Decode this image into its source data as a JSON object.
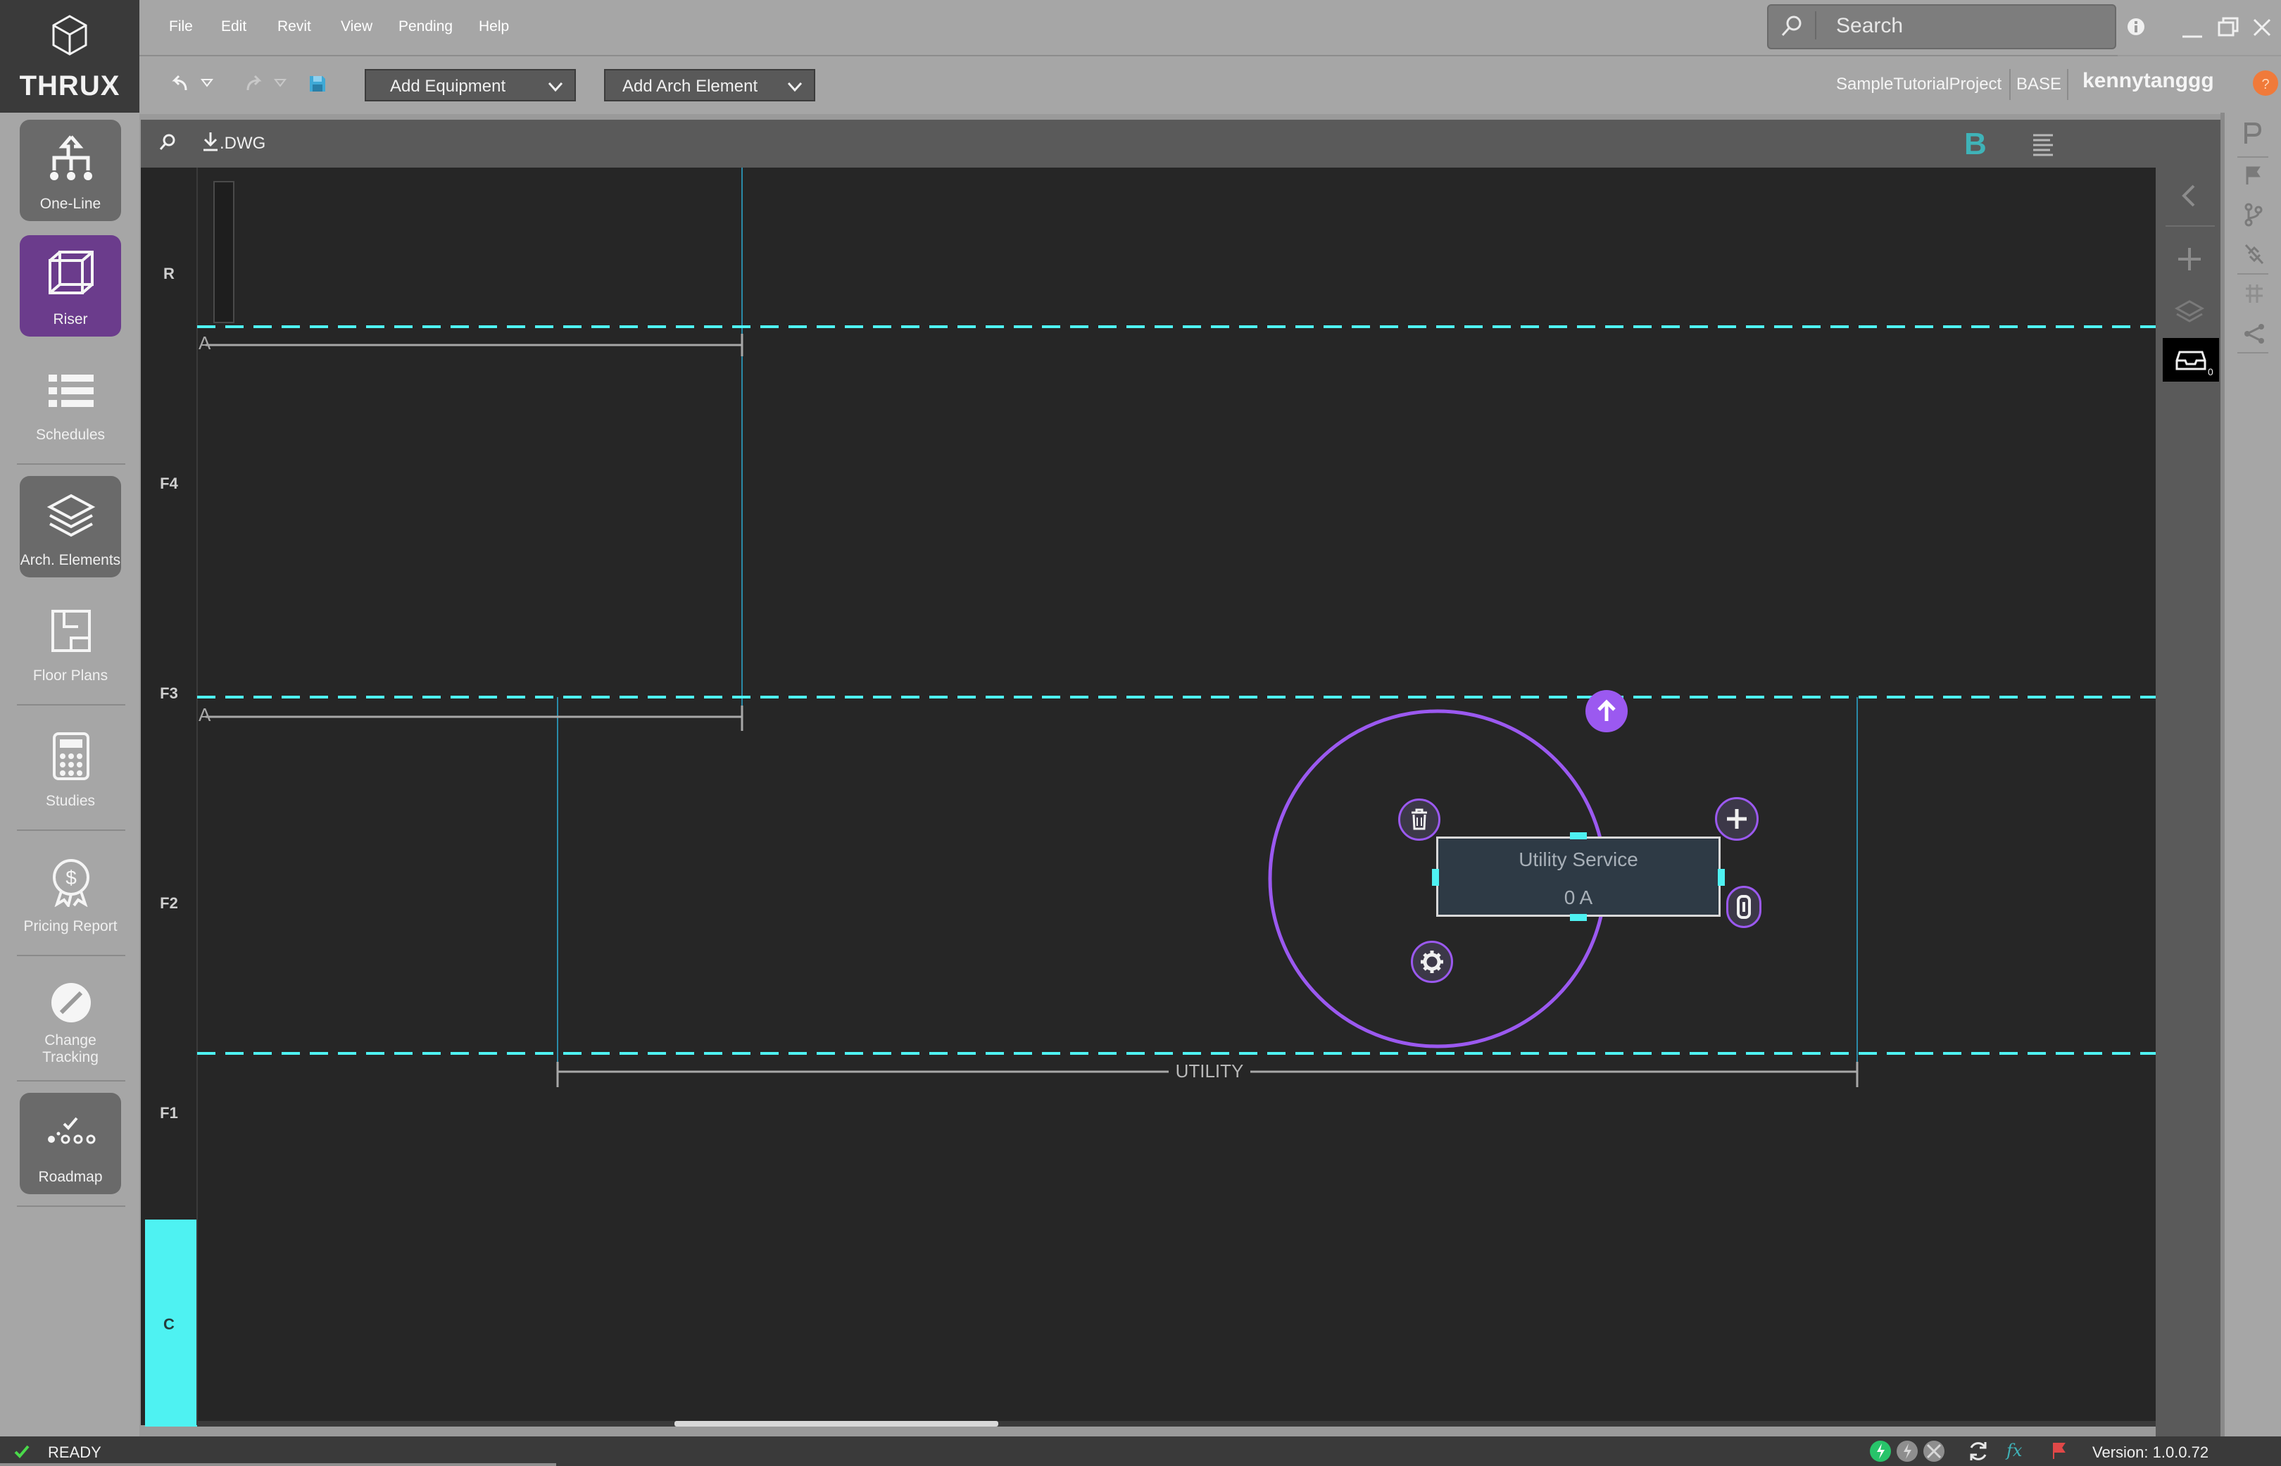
{
  "app": {
    "logo_text": "THRUX",
    "accent_color": "#4ef2f2",
    "selected_color": "#9b59f0"
  },
  "menu": {
    "items": [
      {
        "label": "File"
      },
      {
        "label": "Edit"
      },
      {
        "label": "Revit"
      },
      {
        "label": "View"
      },
      {
        "label": "Pending"
      },
      {
        "label": "Help"
      }
    ]
  },
  "search": {
    "placeholder": "Search"
  },
  "toolbar": {
    "add_equipment": "Add Equipment",
    "add_arch_element": "Add Arch Element"
  },
  "project": {
    "name": "SampleTutorialProject",
    "branch": "BASE",
    "user": "kennytanggg"
  },
  "sidebar": {
    "items": [
      {
        "label": "One-Line"
      },
      {
        "label": "Riser"
      },
      {
        "label": "Schedules"
      },
      {
        "label": "Arch. Elements"
      },
      {
        "label": "Floor Plans"
      },
      {
        "label": "Studies"
      },
      {
        "label": "Pricing Report"
      },
      {
        "label": "Change\nTracking"
      },
      {
        "label": "Roadmap"
      }
    ]
  },
  "canvas_toolbar": {
    "dwg_label": ".DWG",
    "b_label": "B"
  },
  "floors": [
    {
      "label": "R"
    },
    {
      "label": "F4"
    },
    {
      "label": "F3"
    },
    {
      "label": "F2"
    },
    {
      "label": "F1"
    },
    {
      "label": "C"
    }
  ],
  "diagram": {
    "room_marker_1": "A",
    "room_marker_2": "A",
    "utility_label": "UTILITY",
    "equipment": {
      "name": "Utility Service",
      "value": "0 A"
    }
  },
  "inbox_count": "0",
  "status": {
    "state": "READY",
    "version": "Version: 1.0.0.72",
    "fx": "fx"
  }
}
